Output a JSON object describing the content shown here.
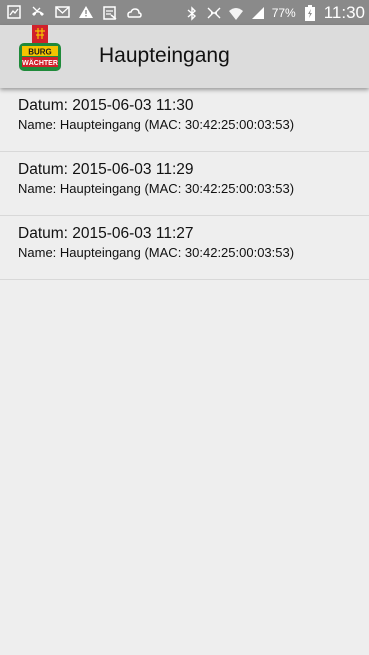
{
  "status_bar": {
    "battery_percent": "77%",
    "time": "11:30",
    "icons_left": [
      "image-icon",
      "missed-call-icon",
      "mail-icon",
      "warning-icon",
      "clipboard-icon",
      "cloud-icon"
    ],
    "icons_right": [
      "bluetooth-icon",
      "nfc-icon",
      "wifi-icon",
      "signal-icon",
      "battery-icon"
    ]
  },
  "app_bar": {
    "title": "Haupteingang",
    "logo_text_top": "BURG",
    "logo_text_bottom": "WÄCHTER"
  },
  "entries": [
    {
      "date": "Datum: 2015-06-03 11:30",
      "name": "Name: Haupteingang (MAC: 30:42:25:00:03:53)"
    },
    {
      "date": "Datum: 2015-06-03 11:29",
      "name": "Name: Haupteingang (MAC: 30:42:25:00:03:53)"
    },
    {
      "date": "Datum: 2015-06-03 11:27",
      "name": "Name: Haupteingang (MAC: 30:42:25:00:03:53)"
    }
  ]
}
